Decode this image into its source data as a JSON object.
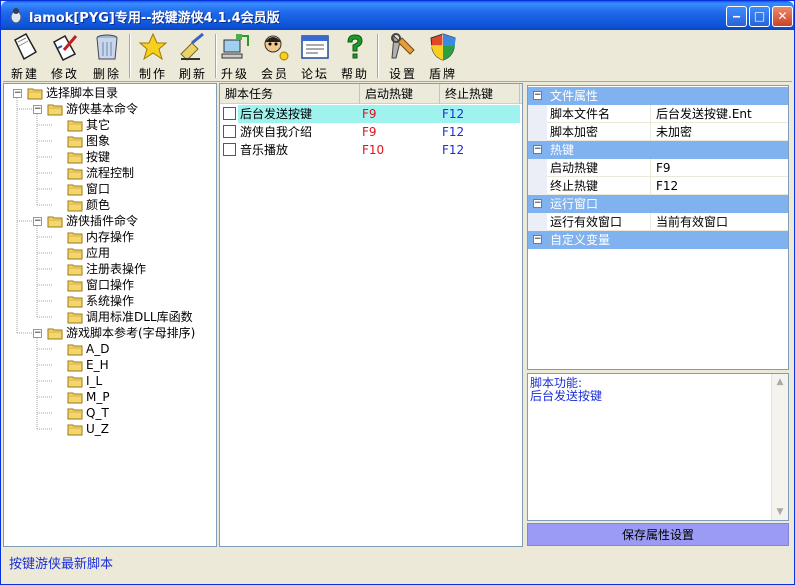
{
  "window": {
    "title": "lamok[PYG]专用--按键游侠4.1.4会员版",
    "min_glyph": "‒",
    "max_glyph": "□",
    "close_glyph": "✕"
  },
  "toolbar": {
    "new": "新建",
    "edit": "修改",
    "delete": "删除",
    "create": "制作",
    "refresh": "刷新",
    "upgrade": "升级",
    "member": "会员",
    "forum": "论坛",
    "help": "帮助",
    "settings": "设置",
    "shield": "盾牌"
  },
  "tree": {
    "root": "选择脚本目录",
    "groups": [
      {
        "label": "游侠基本命令",
        "children": [
          "其它",
          "图象",
          "按键",
          "流程控制",
          "窗口",
          "颜色"
        ]
      },
      {
        "label": "游侠插件命令",
        "children": [
          "内存操作",
          "应用",
          "注册表操作",
          "窗口操作",
          "系统操作",
          "调用标准DLL库函数"
        ]
      },
      {
        "label": "游戏脚本参考(字母排序)",
        "children": [
          "A_D",
          "E_H",
          "I_L",
          "M_P",
          "Q_T",
          "U_Z"
        ]
      }
    ]
  },
  "tasks": {
    "columns": [
      "脚本任务",
      "启动热键",
      "终止热键"
    ],
    "rows": [
      {
        "name": "后台发送按键",
        "start": "F9",
        "stop": "F12"
      },
      {
        "name": "游侠自我介绍",
        "start": "F9",
        "stop": "F12"
      },
      {
        "name": "音乐播放",
        "start": "F10",
        "stop": "F12"
      }
    ]
  },
  "props": {
    "categories": [
      "文件属性",
      "热键",
      "运行窗口",
      "自定义变量"
    ],
    "rows": [
      {
        "name": "脚本文件名",
        "value": "后台发送按键.Ent"
      },
      {
        "name": "脚本加密",
        "value": "未加密"
      },
      {
        "name": "启动热键",
        "value": "F9"
      },
      {
        "name": "终止热键",
        "value": "F12"
      },
      {
        "name": "运行有效窗口",
        "value": "当前有效窗口"
      }
    ]
  },
  "description": {
    "title": "脚本功能:",
    "text": "后台发送按键"
  },
  "save_button": "保存属性设置",
  "status": "按键游侠最新脚本",
  "colors": {
    "selected_row": "#9ff3ef",
    "category_bar": "#7fb2ef",
    "save_button": "#9b9bf5",
    "hotkey_start": "#e0101c",
    "hotkey_stop": "#1c2fd8"
  }
}
